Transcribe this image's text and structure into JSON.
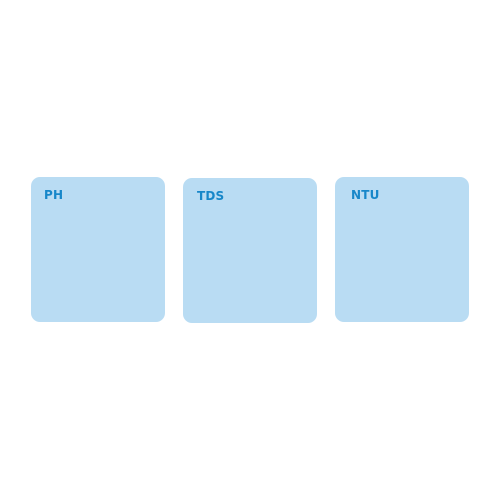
{
  "sensors": [
    {
      "label": "PH"
    },
    {
      "label": "TDS"
    },
    {
      "label": "NTU"
    }
  ],
  "colors": {
    "card_background": "#b9dcf3",
    "label_text": "#1787c9",
    "page_background": "#ffffff"
  }
}
